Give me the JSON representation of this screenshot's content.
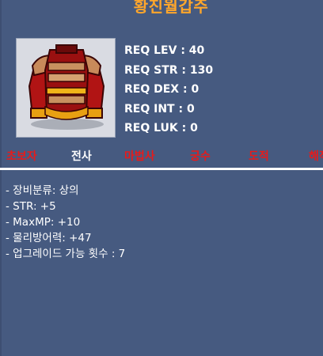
{
  "item": {
    "name": "황진월갑주",
    "icon": "red-armor-top-icon"
  },
  "requirements": [
    "REQ LEV : 40",
    "REQ STR : 130",
    "REQ DEX : 0",
    "REQ INT : 0",
    "REQ LUK : 0"
  ],
  "jobs": [
    {
      "label": "초보자",
      "allowed": false
    },
    {
      "label": "전사",
      "allowed": true
    },
    {
      "label": "마법사",
      "allowed": false
    },
    {
      "label": "궁수",
      "allowed": false
    },
    {
      "label": "도적",
      "allowed": false
    },
    {
      "label": "해적",
      "allowed": false
    }
  ],
  "stats": [
    "- 장비분류: 상의",
    "- STR: +5",
    "- MaxMP: +10",
    "- 물리방어력: +47",
    "- 업그레이드 가능 횟수 : 7"
  ],
  "colors": {
    "background": "#465a80",
    "title": "#ffa62b",
    "job_allowed": "#ffffff",
    "job_disallowed": "#e81a1a"
  }
}
